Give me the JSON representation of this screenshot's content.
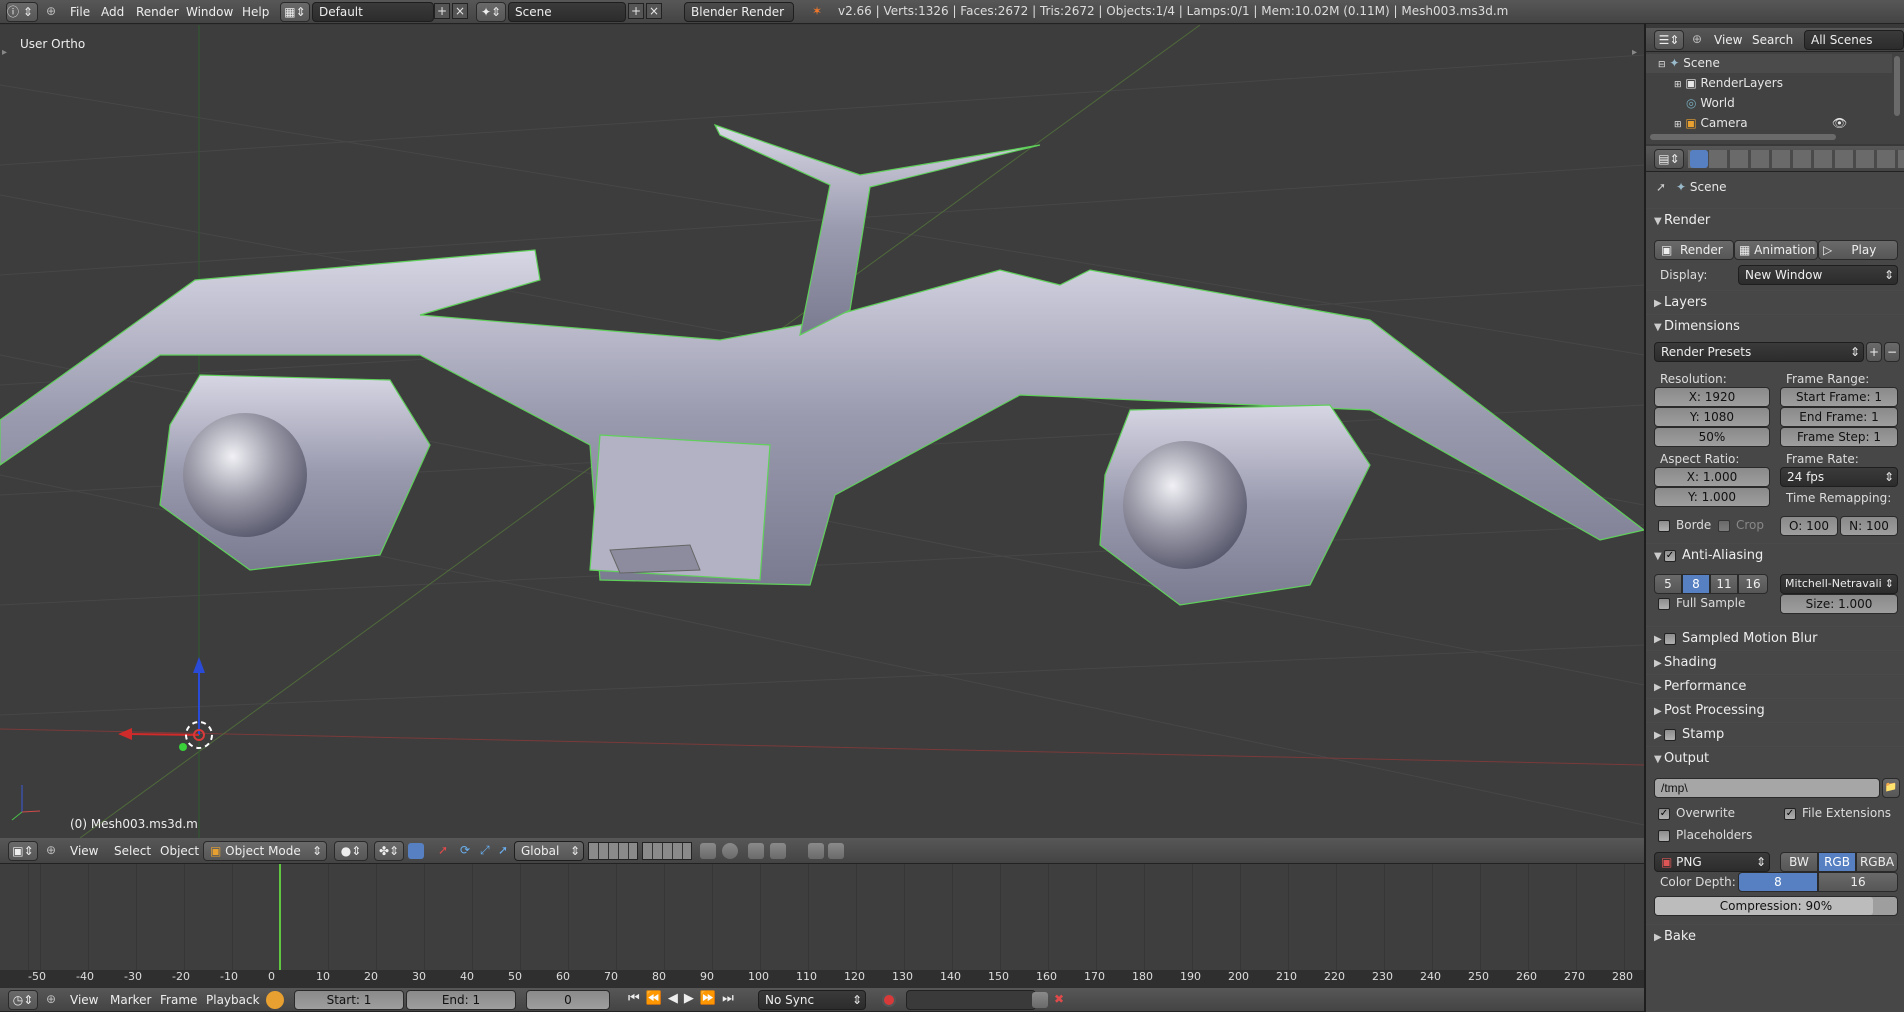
{
  "top_bar": {
    "menus": [
      "File",
      "Add",
      "Render",
      "Window",
      "Help"
    ],
    "layout": "Default",
    "scene": "Scene",
    "engine": "Blender Render",
    "stats": "v2.66 | Verts:1326 | Faces:2672 | Tris:2672 | Objects:1/4 | Lamps:0/1 | Mem:10.02M (0.11M) | Mesh003.ms3d.m"
  },
  "viewport": {
    "view_label": "User Ortho",
    "object_label": "(0) Mesh003.ms3d.m"
  },
  "view3d_header": {
    "menus": [
      "View",
      "Select",
      "Object"
    ],
    "mode": "Object Mode",
    "orientation": "Global"
  },
  "outliner": {
    "menus": [
      "View",
      "Search"
    ],
    "filter": "All Scenes",
    "items": [
      "Scene",
      "RenderLayers",
      "World",
      "Camera"
    ]
  },
  "properties": {
    "context": "Scene",
    "render": {
      "title": "Render",
      "render_btn": "Render",
      "animation_btn": "Animation",
      "play_btn": "Play",
      "display_label": "Display:",
      "display_value": "New Window"
    },
    "collapsed_a": [
      "Layers"
    ],
    "dimensions": {
      "title": "Dimensions",
      "presets": "Render Presets",
      "resolution_label": "Resolution:",
      "res_x": "X: 1920",
      "res_y": "Y: 1080",
      "res_pct": "50%",
      "frame_range_label": "Frame Range:",
      "start": "Start Frame: 1",
      "end": "End Frame: 1",
      "step": "Frame Step: 1",
      "aspect_label": "Aspect Ratio:",
      "asp_x": "X: 1.000",
      "asp_y": "Y: 1.000",
      "frame_rate_label": "Frame Rate:",
      "fps": "24 fps",
      "time_remap_label": "Time Remapping:",
      "border": "Borde",
      "crop": "Crop",
      "remap_old": "O: 100",
      "remap_new": "N: 100"
    },
    "anti_aliasing": {
      "title": "Anti-Aliasing",
      "samples": [
        "5",
        "8",
        "11",
        "16"
      ],
      "selected": "8",
      "filter": "Mitchell-Netravali",
      "full_sample": "Full Sample",
      "size": "Size: 1.000"
    },
    "collapsed_b": [
      "Sampled Motion Blur",
      "Shading",
      "Performance",
      "Post Processing",
      "Stamp"
    ],
    "output": {
      "title": "Output",
      "path": "/tmp\\",
      "overwrite": "Overwrite",
      "file_ext": "File Extensions",
      "placeholders": "Placeholders",
      "format": "PNG",
      "bw": "BW",
      "rgb": "RGB",
      "rgba": "RGBA",
      "color_depth_label": "Color Depth:",
      "depth_8": "8",
      "depth_16": "16",
      "compression": "Compression: 90%",
      "compression_value": 0.9
    },
    "bake": "Bake"
  },
  "timeline": {
    "ticks": [
      "-50",
      "-40",
      "-30",
      "-20",
      "-10",
      "0",
      "10",
      "20",
      "30",
      "40",
      "50",
      "60",
      "70",
      "80",
      "90",
      "100",
      "110",
      "120",
      "130",
      "140",
      "150",
      "160",
      "170",
      "180",
      "190",
      "200",
      "210",
      "220",
      "230",
      "240",
      "250",
      "260",
      "270",
      "280"
    ],
    "menus": [
      "View",
      "Marker",
      "Frame",
      "Playback"
    ],
    "start": "Start: 1",
    "end": "End: 1",
    "current": "0",
    "sync": "No Sync"
  },
  "colors": {
    "accent": "#5680c2",
    "wire_select": "#6fc06a",
    "frame_line": "#60c840",
    "bg": "#393939"
  }
}
